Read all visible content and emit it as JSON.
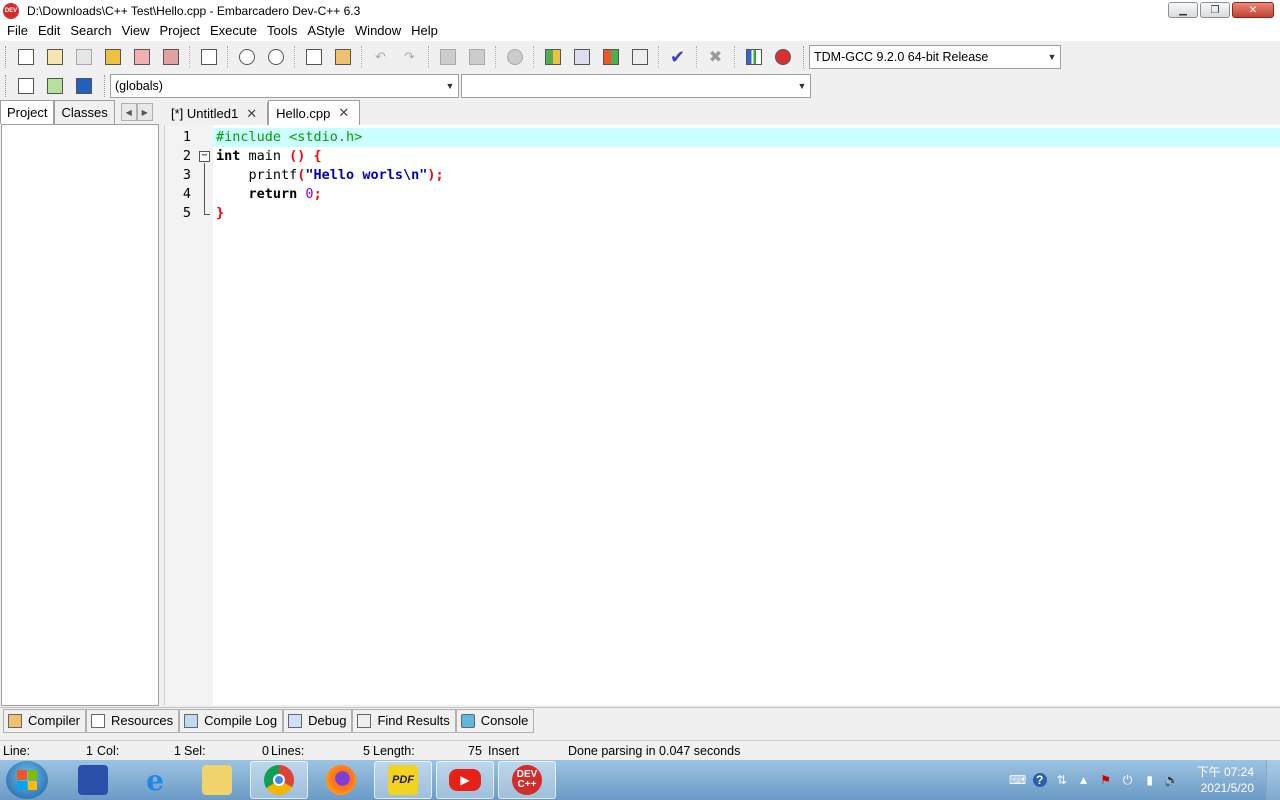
{
  "window": {
    "title": "D:\\Downloads\\C++ Test\\Hello.cpp - Embarcadero Dev-C++ 6.3",
    "logo_text": "DEV"
  },
  "menu": [
    "File",
    "Edit",
    "Search",
    "View",
    "Project",
    "Execute",
    "Tools",
    "AStyle",
    "Window",
    "Help"
  ],
  "toolbar": {
    "compiler_select": "TDM-GCC 9.2.0 64-bit Release",
    "scope_select": "(globals)",
    "function_select": ""
  },
  "left_panel": {
    "tabs": [
      "Project",
      "Classes"
    ]
  },
  "editor_tabs": [
    {
      "label": "[*] Untitled1"
    },
    {
      "label": "Hello.cpp"
    }
  ],
  "code": {
    "line_numbers": [
      "1",
      "2",
      "3",
      "4",
      "5"
    ],
    "line1": "#include <stdio.h>",
    "line2_kw": "int",
    "line2_name": " main ",
    "line2_sym": "() {",
    "line3_indent": "    printf",
    "line3_open": "(",
    "line3_str": "\"Hello worls\\n\"",
    "line3_close": ");",
    "line4_indent": "    ",
    "line4_kw": "return",
    "line4_num": " 0",
    "line4_sym": ";",
    "line5_sym": "}"
  },
  "bottom_tabs": [
    "Compiler",
    "Resources",
    "Compile Log",
    "Debug",
    "Find Results",
    "Console"
  ],
  "status": {
    "line_label": "Line:",
    "line_value": "1",
    "col_label": "Col:",
    "col_value": "1",
    "sel_label": "Sel:",
    "sel_value": "0",
    "lines_label": "Lines:",
    "lines_value": "5",
    "length_label": "Length:",
    "length_value": "75",
    "mode": "Insert",
    "message": "Done parsing in 0.047 seconds"
  },
  "taskbar": {
    "apps": [
      "save-disk",
      "internet-explorer",
      "file-explorer",
      "chrome",
      "firefox",
      "pdf-reader",
      "youtube",
      "dev-cpp"
    ],
    "pdf_label": "PDF",
    "devcpp_label": "DEV C++",
    "clock_time": "下午 07:24",
    "clock_date": "2021/5/20"
  },
  "colors": {
    "current_line": "#ccffff",
    "preprocessor": "#00a000",
    "string": "#0000c0",
    "symbol": "#ff0000",
    "number": "#8000ff"
  }
}
